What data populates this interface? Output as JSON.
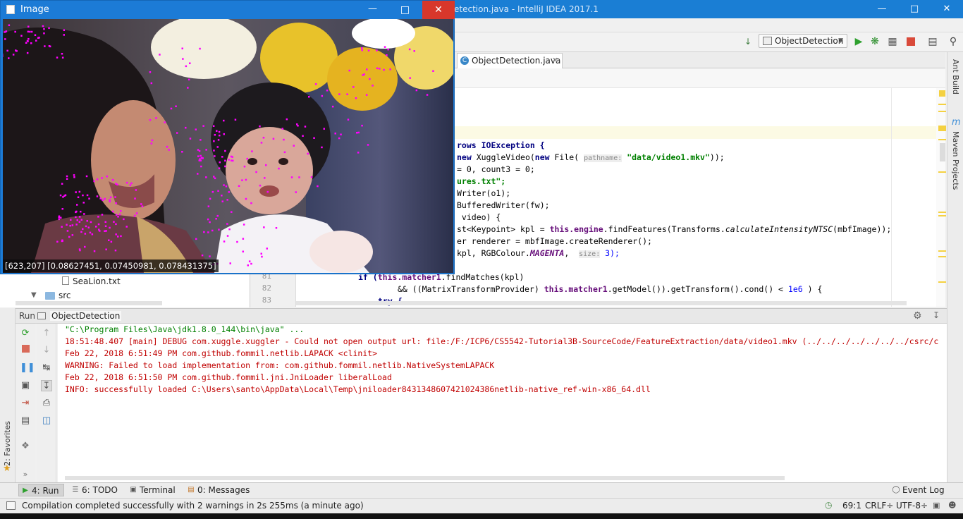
{
  "ide": {
    "title": "...ectDetection.java - IntelliJ IDEA 2017.1",
    "title_visible": "etection.java - IntelliJ IDEA 2017.1",
    "run_config": "ObjectDetection",
    "editor_tab": "ObjectDetection.java"
  },
  "image_window": {
    "title": "Image",
    "readout": "[623,207] [0.08627451, 0.07450981, 0.078431375]"
  },
  "code": {
    "l1": "rows IOException {",
    "l2a": "new XuggleVideo(new File(",
    "l2hint": "pathname:",
    "l2b": "\"data/video1.mkv\"));",
    "l3": "= 0, count3 = 0;",
    "l4": "ures.txt\";",
    "l5": "Writer(o1);",
    "l6": "BufferedWriter(fw);",
    "l7": " video) {",
    "l8a": "st<Keypoint> kpl = ",
    "l8b": "this.engine",
    "l8c": ".findFeatures(Transforms.",
    "l8d": "calculateIntensityNTSC",
    "l8e": "(mbfImage));",
    "l9": "er renderer = mbfImage.createRenderer();",
    "l10a": "kpl, RGBColour.",
    "l10b": "MAGENTA",
    "l10c": ",",
    "l10hint": "size:",
    "l10d": "3);",
    "ln81": "81",
    "ln82": "82",
    "ln83": "83",
    "c81a": "if (",
    "c81b": "this.matcher1",
    "c81c": ".findMatches(kpl)",
    "c82a": "&& ((MatrixTransformProvider) ",
    "c82b": "this.matcher1",
    "c82c": ".getModel()).getTransform().cond() < ",
    "c82d": "1e6",
    "c82e": " ) {",
    "c83": "try {"
  },
  "project": {
    "file": "SeaLion.txt",
    "folder": "src"
  },
  "run_panel": {
    "label": "Run",
    "config": "ObjectDetection",
    "console": [
      "\"C:\\Program Files\\Java\\jdk1.8.0_144\\bin\\java\" ...",
      "18:51:48.407 [main] DEBUG com.xuggle.xuggler - Could not open output url: file:/F:/ICP6/CS5542-Tutorial3B-SourceCode/FeatureExtraction/data/video1.mkv (../../../../../../../csrc/c",
      "Feb 22, 2018 6:51:49 PM com.github.fommil.netlib.LAPACK <clinit>",
      "WARNING: Failed to load implementation from: com.github.fommil.netlib.NativeSystemLAPACK",
      "Feb 22, 2018 6:51:50 PM com.github.fommil.jni.JniLoader liberalLoad",
      "INFO: successfully loaded C:\\Users\\santo\\AppData\\Local\\Temp\\jniloader8431348607421024386netlib-native_ref-win-x86_64.dll"
    ]
  },
  "tool_tabs": {
    "run": "4: Run",
    "todo": "6: TODO",
    "terminal": "Terminal",
    "messages": "0: Messages",
    "event_log": "Event Log"
  },
  "side": {
    "ant": "Ant Build",
    "maven": "Maven Projects",
    "favorites": "2: Favorites"
  },
  "status": {
    "message": "Compilation completed successfully with 2 warnings in 2s 255ms (a minute ago)",
    "position": "69:1",
    "line_sep": "CRLF÷",
    "encoding": "UTF-8÷"
  },
  "colors": {
    "title_bar": "#1a7ed4",
    "console_text": "#c00000",
    "keyword": "#000080",
    "field": "#660e7a",
    "string": "#008000",
    "keypoints": "#ff00ff"
  }
}
